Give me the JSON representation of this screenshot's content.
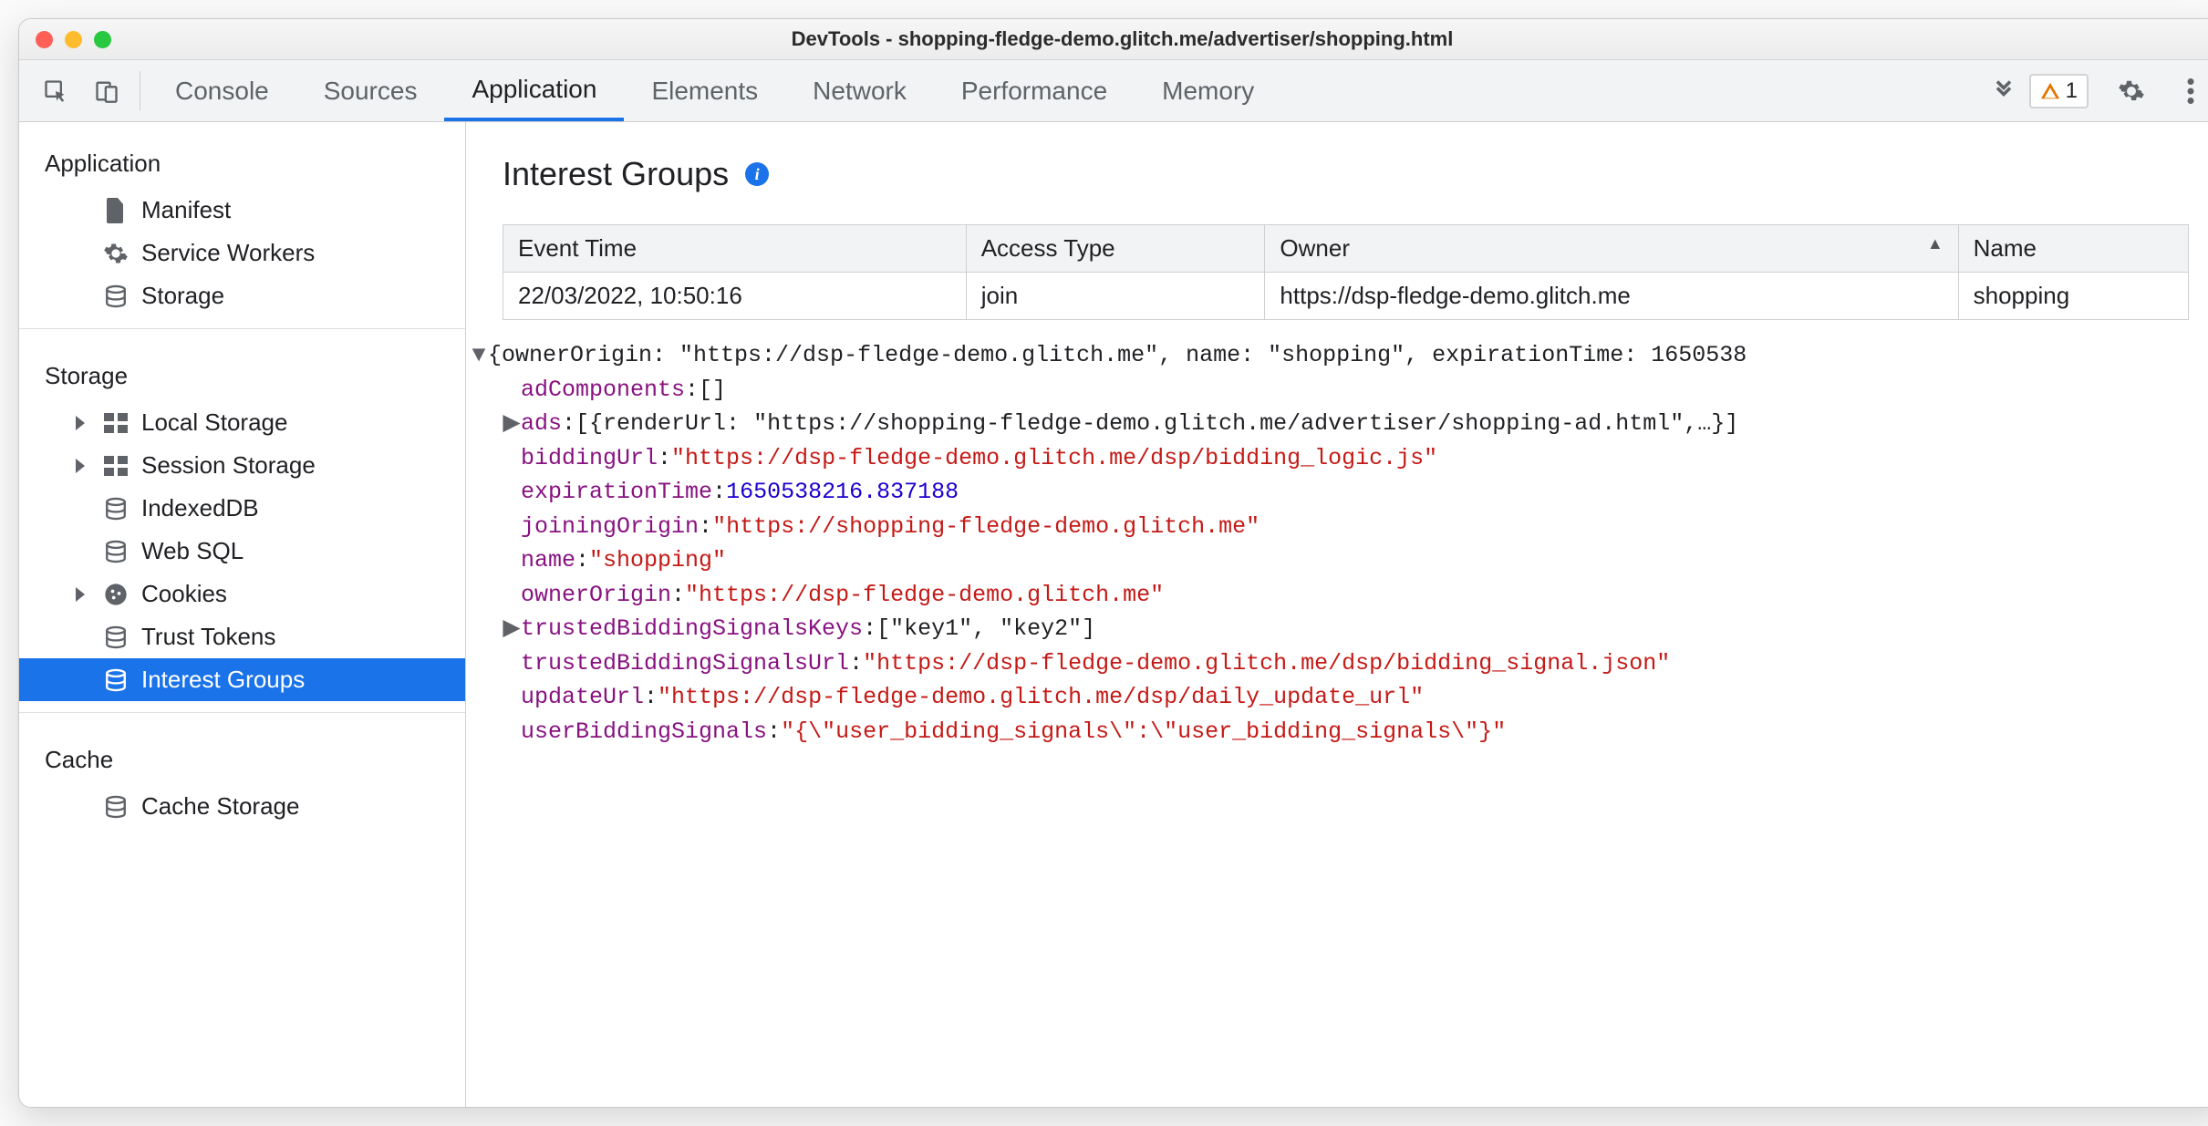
{
  "titlebar": {
    "title": "DevTools - shopping-fledge-demo.glitch.me/advertiser/shopping.html"
  },
  "toolbar": {
    "tabs": [
      "Console",
      "Sources",
      "Application",
      "Elements",
      "Network",
      "Performance",
      "Memory"
    ],
    "active_tab": "Application",
    "warning_count": "1"
  },
  "sidebar": {
    "sections": [
      {
        "title": "Application",
        "items": [
          {
            "icon": "file-icon",
            "label": "Manifest",
            "expandable": false
          },
          {
            "icon": "gear-icon",
            "label": "Service Workers",
            "expandable": false
          },
          {
            "icon": "db-icon",
            "label": "Storage",
            "expandable": false
          }
        ]
      },
      {
        "title": "Storage",
        "items": [
          {
            "icon": "grid-icon",
            "label": "Local Storage",
            "expandable": true
          },
          {
            "icon": "grid-icon",
            "label": "Session Storage",
            "expandable": true
          },
          {
            "icon": "db-icon",
            "label": "IndexedDB",
            "expandable": false
          },
          {
            "icon": "db-icon",
            "label": "Web SQL",
            "expandable": false
          },
          {
            "icon": "cookie-icon",
            "label": "Cookies",
            "expandable": true
          },
          {
            "icon": "db-icon",
            "label": "Trust Tokens",
            "expandable": false
          },
          {
            "icon": "db-icon",
            "label": "Interest Groups",
            "expandable": false,
            "selected": true
          }
        ]
      },
      {
        "title": "Cache",
        "items": [
          {
            "icon": "db-icon",
            "label": "Cache Storage",
            "expandable": false
          }
        ]
      }
    ]
  },
  "content": {
    "title": "Interest Groups",
    "table": {
      "columns": [
        "Event Time",
        "Access Type",
        "Owner",
        "Name"
      ],
      "sorted_column": "Owner",
      "rows": [
        {
          "Event Time": "22/03/2022, 10:50:16",
          "Access Type": "join",
          "Owner": "https://dsp-fledge-demo.glitch.me",
          "Name": "shopping"
        }
      ]
    },
    "object_summary": "{ownerOrigin: \"https://dsp-fledge-demo.glitch.me\", name: \"shopping\", expirationTime: 1650538",
    "object": {
      "adComponents": "[]",
      "ads": "[{renderUrl: \"https://shopping-fledge-demo.glitch.me/advertiser/shopping-ad.html\",…}]",
      "biddingUrl": "\"https://dsp-fledge-demo.glitch.me/dsp/bidding_logic.js\"",
      "expirationTime": "1650538216.837188",
      "joiningOrigin": "\"https://shopping-fledge-demo.glitch.me\"",
      "name": "\"shopping\"",
      "ownerOrigin": "\"https://dsp-fledge-demo.glitch.me\"",
      "trustedBiddingSignalsKeys": "[\"key1\", \"key2\"]",
      "trustedBiddingSignalsUrl": "\"https://dsp-fledge-demo.glitch.me/dsp/bidding_signal.json\"",
      "updateUrl": "\"https://dsp-fledge-demo.glitch.me/dsp/daily_update_url\"",
      "userBiddingSignals": "\"{\\\"user_bidding_signals\\\":\\\"user_bidding_signals\\\"}\""
    },
    "object_meta": {
      "ads_expandable": true,
      "trustedBiddingSignalsKeys_expandable": true,
      "numeric_keys": [
        "expirationTime"
      ],
      "plain_keys": [
        "adComponents",
        "ads",
        "trustedBiddingSignalsKeys"
      ]
    }
  }
}
